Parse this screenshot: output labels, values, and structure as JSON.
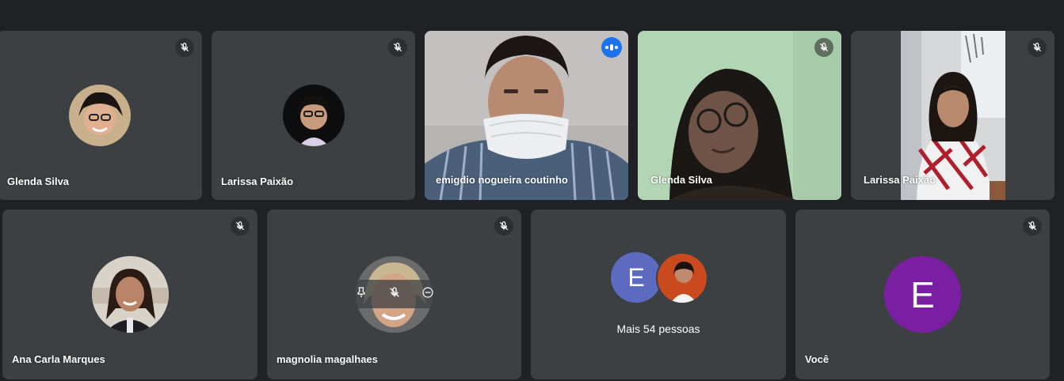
{
  "participants": [
    {
      "name": "Glenda Silva",
      "muted": true,
      "view": "avatar"
    },
    {
      "name": "Larissa Paixão",
      "muted": true,
      "view": "avatar"
    },
    {
      "name": "emigdio nogueira coutinho",
      "muted": false,
      "speaking": true,
      "view": "video"
    },
    {
      "name": "Glenda Silva",
      "muted": true,
      "view": "video"
    },
    {
      "name": "Larissa Paixão",
      "muted": true,
      "view": "video"
    },
    {
      "name": "Ana Carla Marques",
      "muted": true,
      "view": "avatar"
    },
    {
      "name": "magnolia magalhaes",
      "muted": true,
      "view": "avatar"
    },
    {
      "name": "Você",
      "muted": true,
      "view": "letter",
      "initial": "E"
    }
  ],
  "others_tile": {
    "label": "Mais 54 pessoas",
    "initial": "E"
  },
  "colors": {
    "background": "#202124",
    "tile": "#3c4043",
    "active_border": "#8ab4f8",
    "speaking_badge": "#1a73e8",
    "others_initial_bg": "#5c6bc0",
    "self_initial_bg": "#7b1fa2"
  },
  "icons": {
    "muted": "mic-off-icon",
    "speaking": "audio-level-icon",
    "pin": "pin-icon",
    "remove": "remove-icon"
  }
}
